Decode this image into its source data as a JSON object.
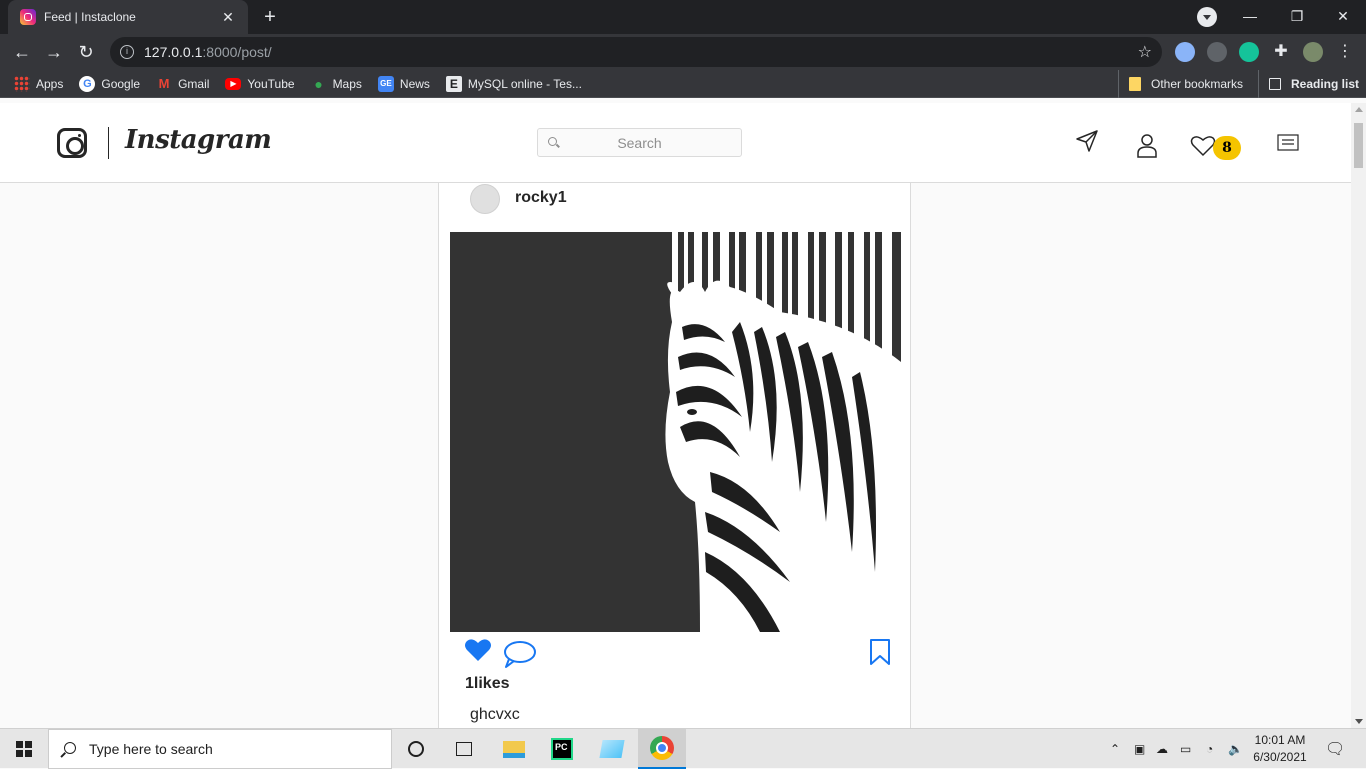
{
  "browser": {
    "tab_title": "Feed | Instaclone",
    "url_host": "127.0.0.1",
    "url_path": ":8000/post/",
    "bookmarks": [
      {
        "label": "Apps",
        "icon": "apps-grid-icon"
      },
      {
        "label": "Google",
        "icon": "google-icon"
      },
      {
        "label": "Gmail",
        "icon": "gmail-icon"
      },
      {
        "label": "YouTube",
        "icon": "youtube-icon"
      },
      {
        "label": "Maps",
        "icon": "maps-pin-icon"
      },
      {
        "label": "News",
        "icon": "news-icon"
      },
      {
        "label": "MySQL online - Tes...",
        "icon": "e-letter-icon"
      }
    ],
    "other_bookmarks": "Other bookmarks",
    "reading_list": "Reading list"
  },
  "nav": {
    "wordmark": "Instagram",
    "search_placeholder": "Search",
    "notification_count": "8"
  },
  "post": {
    "username": "rocky1",
    "likes_text": "1likes",
    "caption": "ghcvxc",
    "image_subject": "zebra-barcode-illustration"
  },
  "taskbar": {
    "search_placeholder": "Type here to search",
    "time": "10:01 AM",
    "date": "6/30/2021"
  },
  "colors": {
    "like_blue": "#1877f2",
    "badge_yellow": "#f5c400",
    "chrome_dark": "#35363a"
  }
}
